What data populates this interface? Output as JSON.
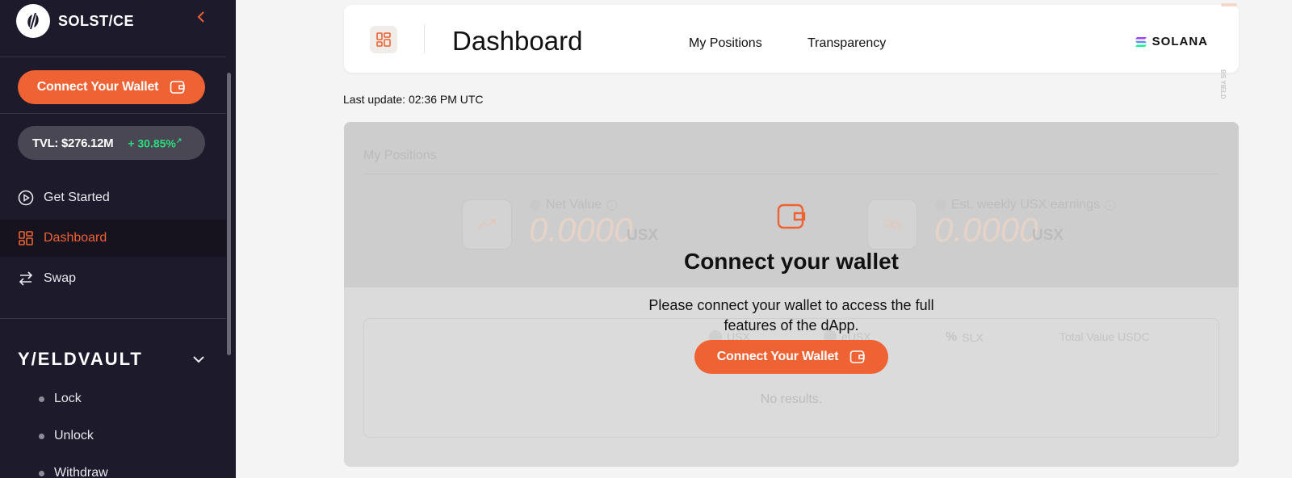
{
  "brand": {
    "name": "SOLST/CE"
  },
  "sidebar": {
    "connect_label": "Connect Your Wallet",
    "tvl_label": "TVL: $276.12M",
    "tvl_change": "+ 30.85%",
    "nav": [
      {
        "label": "Get Started",
        "icon": "play-circle-icon"
      },
      {
        "label": "Dashboard",
        "icon": "grid-icon"
      },
      {
        "label": "Swap",
        "icon": "swap-arrows-icon"
      }
    ],
    "yieldvault": {
      "logo": "Y/ELDVAULT",
      "items": [
        {
          "label": "Lock"
        },
        {
          "label": "Unlock"
        },
        {
          "label": "Withdraw"
        }
      ]
    }
  },
  "header": {
    "title": "Dashboard",
    "links": [
      "My Positions",
      "Transparency"
    ],
    "network": "SOLANA",
    "side_tag": "BS YIELD"
  },
  "main": {
    "last_update_label": "Last update:",
    "last_update_time": "02:36 PM UTC",
    "positions": {
      "title": "My Positions",
      "net_value_label": "Net Value",
      "net_value": "0.0000",
      "net_value_unit": "USX",
      "weekly_label": "Est. weekly USX earnings",
      "weekly_value": "0.0000",
      "weekly_unit": "USX",
      "table_headers": [
        "USX",
        "eUSX",
        "SLX",
        "Total Value USDC"
      ],
      "no_results": "No results."
    },
    "overlay": {
      "title": "Connect your wallet",
      "text": "Please connect your wallet to access the full features of the dApp.",
      "button_label": "Connect Your Wallet"
    }
  },
  "colors": {
    "accent": "#ef6233",
    "sidebar_bg": "#1d1a2b",
    "positive": "#2bdc7c"
  }
}
